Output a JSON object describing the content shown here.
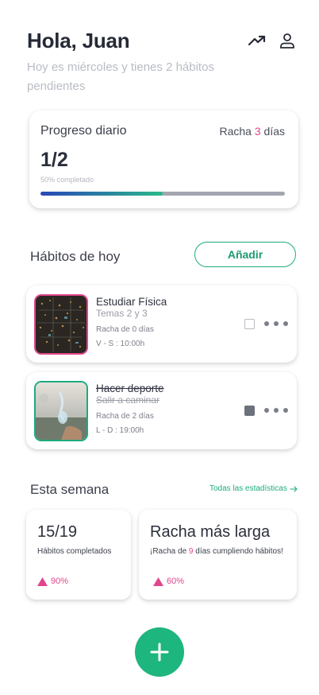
{
  "header": {
    "greeting": "Hola, Juan",
    "subtitle": "Hoy es miércoles y tienes 2 hábitos pendientes",
    "icons": [
      "trending-up-icon",
      "user-icon"
    ]
  },
  "progress": {
    "title": "Progreso diario",
    "streak_prefix": "Racha",
    "streak_value": "3",
    "streak_suffix": "días",
    "count": "1/2",
    "percent_text": "50% completado",
    "fraction": 0.5
  },
  "habits_section": {
    "title": "Hábitos de hoy",
    "add_label": "Añadir",
    "items": [
      {
        "name": "Estudiar Física",
        "description": "Temas 2 y 3",
        "streak": "Racha de 0 días",
        "schedule": "V - S : 10:00h",
        "done": false,
        "border_color": "#e0468b"
      },
      {
        "name": "Hacer deporte",
        "description": "Salir a caminar",
        "streak": "Racha de 2 días",
        "schedule": "L - D : 19:00h",
        "done": true,
        "border_color": "#1dab7e"
      }
    ]
  },
  "week_section": {
    "title": "Esta semana",
    "link_label": "Todas las estadísticas",
    "stats": [
      {
        "value": "15/19",
        "label": "Hábitos completados",
        "trend": "90%"
      },
      {
        "value": "Racha más larga",
        "label_prefix": "¡Racha de ",
        "label_value": "9",
        "label_suffix": " días cumpliendo hábitos!",
        "trend": "60%"
      }
    ]
  },
  "colors": {
    "accent_green": "#1dab7e",
    "accent_pink": "#e0468b",
    "fab": "#1db67e"
  }
}
